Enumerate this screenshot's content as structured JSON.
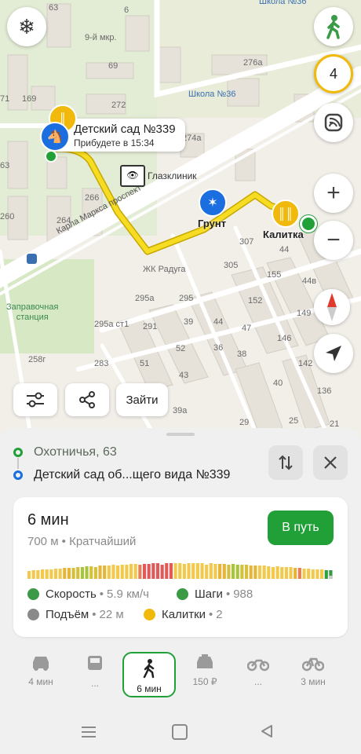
{
  "map": {
    "streets": {
      "karla_marksa": "Карла Маркса проспект",
      "zhk": "ЖК Радуга",
      "district": "9-й мкр."
    },
    "pois": {
      "school": "Школа №36",
      "school_top": "Школа №36",
      "clinic": "Глазклиник",
      "gas": "Заправочная\nстанция"
    },
    "destination": {
      "title": "Детский сад №339",
      "eta": "Прибудете в 15:34"
    },
    "markers": {
      "grunt": "Грунт",
      "kalitka": "Калитка"
    },
    "house_numbers": [
      "63",
      "6",
      "71",
      "169",
      "63",
      "260",
      "69",
      "272",
      "276а",
      "274а",
      "266",
      "264",
      "307",
      "305",
      "44",
      "155",
      "44в",
      "295а",
      "295",
      "152",
      "149",
      "295а ст1",
      "291",
      "39",
      "44",
      "47",
      "146",
      "258г",
      "52",
      "36",
      "38",
      "142",
      "283",
      "51",
      "43",
      "40",
      "136",
      "39а",
      "29",
      "25",
      "21"
    ],
    "layer_count": "4",
    "buttons": {
      "search": "Зайти"
    }
  },
  "route": {
    "from": "Охотничья, 63",
    "to": "Детский сад об...щего вида №339",
    "time": "6 мин",
    "details": "700 м • Кратчайший",
    "go": "В путь",
    "profile": [
      "#f2c94c",
      "#f2c94c",
      "#f2c94c",
      "#f2c94c",
      "#f2c94c",
      "#f2c94c",
      "#f2c94c",
      "#f2c94c",
      "#e5b53b",
      "#e5b53b",
      "#d4c03a",
      "#d4c03a",
      "#a8c43a",
      "#a8c43a",
      "#d4c03a",
      "#d4c03a",
      "#e5b53b",
      "#e5b53b",
      "#f2c94c",
      "#f2c94c",
      "#f2c94c",
      "#f2c94c",
      "#f2c94c",
      "#f2c94c",
      "#f2c94c",
      "#e57e5a",
      "#e05a5a",
      "#e05a5a",
      "#e05a5a",
      "#e05a5a",
      "#e05a5a",
      "#e05a5a",
      "#e05a5a",
      "#f2c94c",
      "#f2c94c",
      "#f2c94c",
      "#f2c94c",
      "#f2c94c",
      "#f2c94c",
      "#f2c94c",
      "#f2c94c",
      "#f2c94c",
      "#f2c94c",
      "#e5b53b",
      "#e5b53b",
      "#d4c03a",
      "#a8c43a",
      "#a8c43a",
      "#d4c03a",
      "#d4c03a",
      "#e5b53b",
      "#e5b53b",
      "#f2c94c",
      "#f2c94c",
      "#f2c94c",
      "#f2c94c",
      "#f2c94c",
      "#f2c94c",
      "#f2c94c",
      "#f2c94c",
      "#e5b53b",
      "#e57e5a",
      "#f2c94c",
      "#f2c94c",
      "#f2c94c",
      "#f2c94c",
      "#f2c94c",
      "#2e9e3f",
      "#2e9e3f"
    ],
    "stats": {
      "speed_label": "Скорость",
      "speed_value": "5.9 км/ч",
      "steps_label": "Шаги",
      "steps_value": "988",
      "ascent_label": "Подъём",
      "ascent_value": "22 м",
      "gates_label": "Калитки",
      "gates_value": "2"
    }
  },
  "modes": [
    {
      "label": "4 мин",
      "icon": "car-icon"
    },
    {
      "label": "...",
      "icon": "bus-icon"
    },
    {
      "label": "6 мин",
      "icon": "walk-icon"
    },
    {
      "label": "150 ₽",
      "icon": "taxi-icon"
    },
    {
      "label": "...",
      "icon": "motorcycle-icon"
    },
    {
      "label": "3 мин",
      "icon": "bicycle-icon"
    }
  ],
  "colors": {
    "accent_green": "#21a038",
    "route_yellow": "#f2d21b",
    "blue": "#1a73e8",
    "gold": "#f0b90b"
  }
}
